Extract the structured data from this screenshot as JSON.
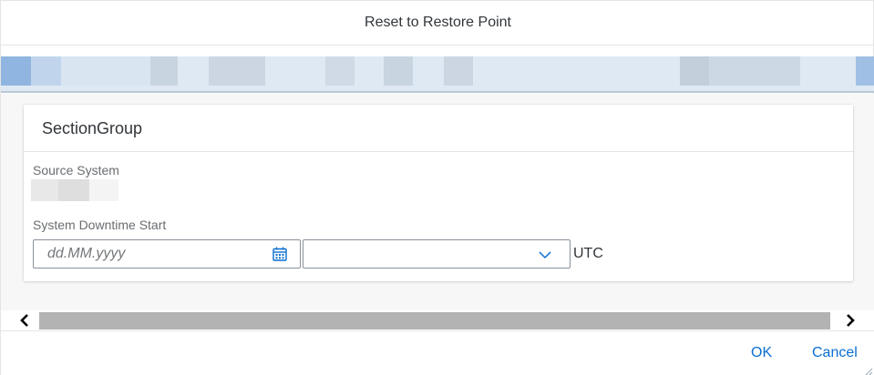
{
  "dialog": {
    "title": "Reset to Restore Point"
  },
  "section": {
    "title": "SectionGroup",
    "source_system_label": "Source System",
    "downtime_label": "System Downtime Start",
    "date_placeholder": "dd.MM.yyyy",
    "timezone_value": "",
    "timezone_suffix": "UTC"
  },
  "footer": {
    "ok_label": "OK",
    "cancel_label": "Cancel"
  },
  "icons": {
    "calendar": "calendar-icon",
    "dropdown": "chevron-down-icon",
    "scroll_left": "chevron-left-icon",
    "scroll_right": "chevron-right-icon"
  },
  "colors": {
    "accent": "#0a6ed1",
    "header_strip": "#dfe9f3",
    "scroll_thumb": "#b3b3b3"
  }
}
